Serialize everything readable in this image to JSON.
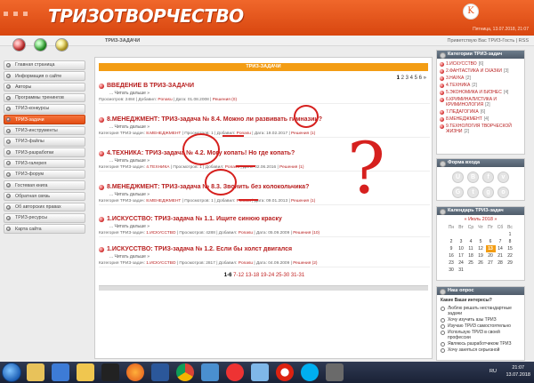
{
  "header": {
    "logo": "ТРИЗОТВОРЧЕСТВО",
    "avatar_glyph": "K",
    "date": "Пятница, 13.07.2018, 21:07"
  },
  "subbar": {
    "title": "ТРИЗ-ЗАДАЧИ",
    "greeting": "Приветствую Вас ТРИЗ-Гость | RSS"
  },
  "sidebar": {
    "items": [
      {
        "label": "Главная страница",
        "active": false
      },
      {
        "label": "Информация о сайте",
        "active": false
      },
      {
        "label": "Авторы",
        "active": false
      },
      {
        "label": "Программы тренингов",
        "active": false
      },
      {
        "label": "ТРИЗ-конкурсы",
        "active": false
      },
      {
        "label": "ТРИЗ-задачи",
        "active": true
      },
      {
        "label": "ТРИЗ-инструменты",
        "active": false
      },
      {
        "label": "ТРИЗ-файлы",
        "active": false
      },
      {
        "label": "ТРИЗ-разработки",
        "active": false
      },
      {
        "label": "ТРИЗ-галерея",
        "active": false
      },
      {
        "label": "ТРИЗ-форум",
        "active": false
      },
      {
        "label": "Гостевая книга",
        "active": false
      },
      {
        "label": "Обратная связь",
        "active": false
      },
      {
        "label": "Об авторских правах",
        "active": false
      },
      {
        "label": "ТРИЗ-ресурсы",
        "active": false
      },
      {
        "label": "Карта сайта",
        "active": false
      }
    ]
  },
  "main": {
    "strip_title": "ТРИЗ-ЗАДАЧИ",
    "pager_top": {
      "current": "1",
      "rest": "2 3 4 5 6 »"
    },
    "entries": [
      {
        "title": "ВВЕДЕНИЕ В ТРИЗ-ЗАДАЧИ",
        "more": "... Читать дальше »",
        "meta_pre": "Просмотров: 2484 | Добавил: ",
        "author": "Ponasu",
        "meta_post": " | Дата: 01.08.2008 | ",
        "comments": "Решения (0)"
      },
      {
        "title": "8.МЕНЕДЖМЕНТ: ТРИЗ-задача № 8.4. Можно ли развивать гимназии?",
        "more": "... Читать дальше »",
        "meta_pre": "Категория ТРИЗ-задач: ",
        "category": "8.МЕНЕДЖМЕНТ",
        "meta_mid": " | Просмотров: 1 | Добавил: ",
        "author": "Ponasu",
        "meta_post": " | Дата: 19.02.2017 | ",
        "comments": "Решения (1)"
      },
      {
        "title": "4.ТЕХНИКА: ТРИЗ-задача № 4.2. Могу копать! Но где копать?",
        "more": "... Читать дальше »",
        "meta_pre": "Категория ТРИЗ-задач: ",
        "category": "4.ТЕХНИКА",
        "meta_mid": " | Просмотров: 1 | Добавил: ",
        "author": "Ponasu",
        "meta_post": " | Дата: 02.06.2016 | ",
        "comments": "Решения (1)"
      },
      {
        "title": "8.МЕНЕДЖМЕНТ: ТРИЗ-задача № 8.3. Звонить без колокольчика?",
        "more": "... Читать дальше »",
        "meta_pre": "Категория ТРИЗ-задач: ",
        "category": "8.МЕНЕДЖМЕНТ",
        "meta_mid": " | Просмотров: 1 | Добавил: ",
        "author": "Ponasu",
        "meta_post": " | Дата: 09.01.2013 | ",
        "comments": "Решения (1)"
      },
      {
        "title": "1.ИСКУССТВО: ТРИЗ-задача № 1.1. Ищите синюю краску",
        "more": "... Читать дальше »",
        "meta_pre": "Категория ТРИЗ-задач: ",
        "category": "1.ИСКУССТВО",
        "meta_mid": " | Просмотров: 4288 | Добавил: ",
        "author": "Ponasu",
        "meta_post": " | Дата: 05.09.2009 | ",
        "comments": "Решения (10)"
      },
      {
        "title": "1.ИСКУССТВО: ТРИЗ-задача № 1.2. Если бы холст двигался",
        "more": "... Читать дальше »",
        "meta_pre": "Категория ТРИЗ-задач: ",
        "category": "1.ИСКУССТВО",
        "meta_mid": " | Просмотров: 2817 | Добавил: ",
        "author": "Ponasu",
        "meta_post": " | Дата: 04.09.2009 | ",
        "comments": "Решения (2)"
      }
    ],
    "pager_bottom": {
      "current": "1-6",
      "rest": " 7-12 13-18 19-24 25-30 31-31"
    }
  },
  "right": {
    "categories_title": "Категории ТРИЗ-задач",
    "categories": [
      {
        "label": "1.ИСКУССТВО",
        "count": "[6]"
      },
      {
        "label": "2.ФАНТАСТИКА И СКАЗКИ",
        "count": "[3]"
      },
      {
        "label": "3.НАУКА",
        "count": "[2]"
      },
      {
        "label": "4.ТЕХНИКА",
        "count": "[2]"
      },
      {
        "label": "5.ЭКОНОМИКА И БИЗНЕС",
        "count": "[4]"
      },
      {
        "label": "6.КРИМИНАЛИСТИКА И КРИМИНОЛОГИЯ",
        "count": "[2]"
      },
      {
        "label": "7.ПЕДАГОГИКА",
        "count": "[6]"
      },
      {
        "label": "8.МЕНЕДЖМЕНТ",
        "count": "[4]"
      },
      {
        "label": "9.ТЕХНОЛОГИЯ ТВОРЧЕСКОЙ ЖИЗНИ",
        "count": "[2]"
      }
    ],
    "login_title": "Форма входа",
    "social": [
      "U",
      "B",
      "f",
      "v",
      "G",
      "t",
      "g",
      "o"
    ],
    "calendar_title": "Календарь ТРИЗ-задач",
    "calendar_month": "« Июль 2018 »",
    "calendar_days": [
      "Пн",
      "Вт",
      "Ср",
      "Чт",
      "Пт",
      "Сб",
      "Вс"
    ],
    "calendar_rows": [
      [
        "",
        "",
        "",
        "",
        "",
        "",
        "1"
      ],
      [
        "2",
        "3",
        "4",
        "5",
        "6",
        "7",
        "8"
      ],
      [
        "9",
        "10",
        "11",
        "12",
        "13",
        "14",
        "15"
      ],
      [
        "16",
        "17",
        "18",
        "19",
        "20",
        "21",
        "22"
      ],
      [
        "23",
        "24",
        "25",
        "26",
        "27",
        "28",
        "29"
      ],
      [
        "30",
        "31",
        "",
        "",
        "",
        "",
        ""
      ]
    ],
    "today": "13",
    "poll_title": "Наш опрос",
    "poll_question": "Какие Ваши интересы?",
    "poll_options": [
      "Люблю решать нестандартные задачи",
      "Хочу изучить азы ТРИЗ",
      "Изучаю ТРИЗ самостоятельно",
      "Использую ТРИЗ в своей профессии",
      "Являюсь разработчиком ТРИЗ",
      "Хочу заняться серьезной"
    ]
  },
  "taskbar": {
    "lang": "RU",
    "time": "21:07",
    "date": "13.07.2018"
  },
  "colors": {
    "brand": "#e9541b",
    "accent": "#f39d14",
    "link": "#b81e1e",
    "annotation": "#d6201e"
  }
}
